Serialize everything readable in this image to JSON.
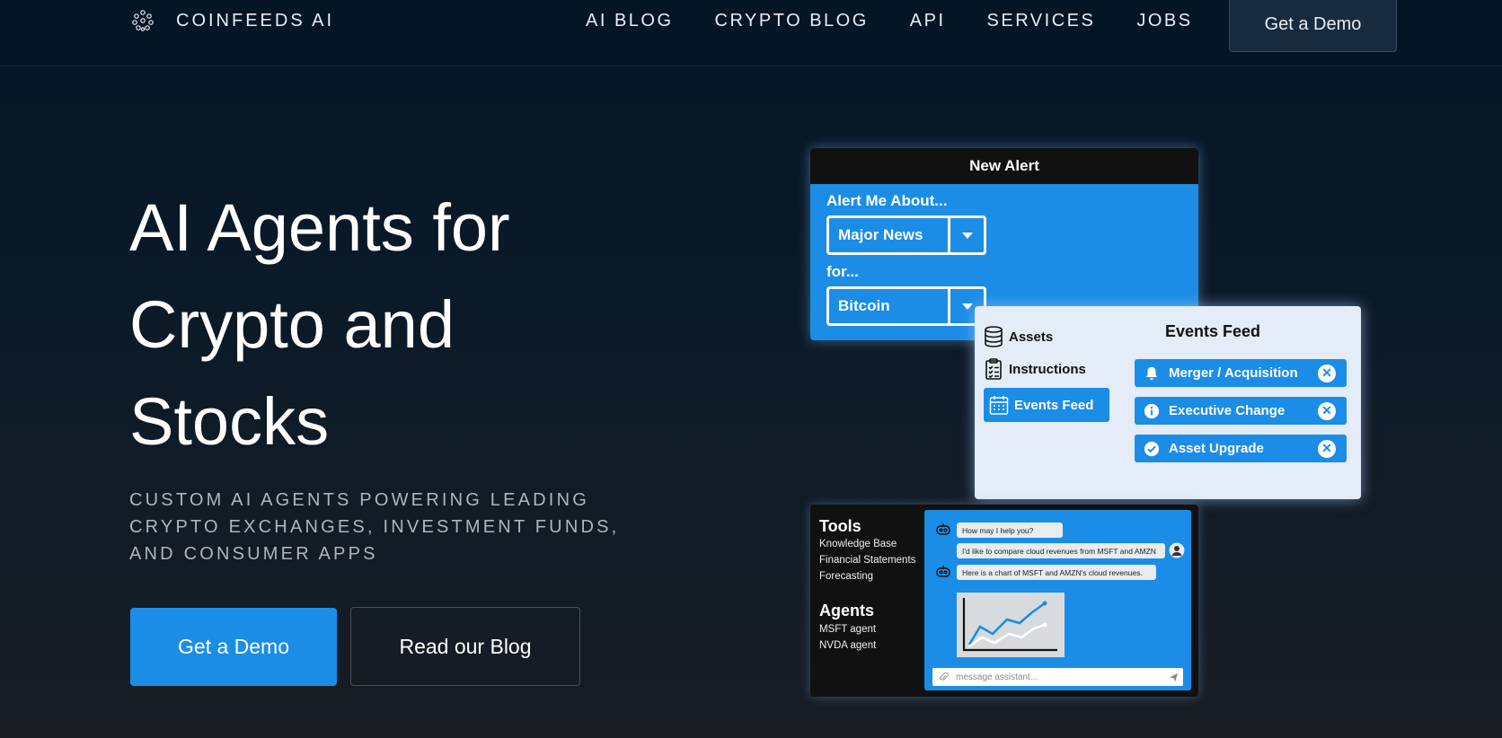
{
  "nav": {
    "brand": "COINFEEDS AI",
    "links": [
      "AI BLOG",
      "CRYPTO BLOG",
      "API",
      "SERVICES",
      "JOBS"
    ],
    "cta": "Get a Demo"
  },
  "hero": {
    "title_line1": "AI Agents for",
    "title_line2": "Crypto and",
    "title_line3": "Stocks",
    "subtitle_line1": "CUSTOM AI AGENTS POWERING LEADING",
    "subtitle_line2": "CRYPTO EXCHANGES, INVESTMENT FUNDS,",
    "subtitle_line3": "AND CONSUMER APPS",
    "primary_cta": "Get a Demo",
    "secondary_cta": "Read our Blog"
  },
  "alert_card": {
    "header": "New Alert",
    "label_about": "Alert Me About...",
    "select_topic": "Major News",
    "label_for": "for...",
    "select_asset": "Bitcoin"
  },
  "events_card": {
    "sidebar": [
      "Assets",
      "Instructions",
      "Events Feed"
    ],
    "title": "Events Feed",
    "items": [
      "Merger / Acquisition",
      "Executive Change",
      "Asset Upgrade"
    ],
    "close_glyph": "✕"
  },
  "chat_card": {
    "tools_heading": "Tools",
    "tools": [
      "Knowledge Base",
      "Financial Statements",
      "Forecasting"
    ],
    "agents_heading": "Agents",
    "agents": [
      "MSFT agent",
      "NVDA agent"
    ],
    "messages": [
      "How may I help you?",
      "I'd like to compare cloud revenues from MSFT and AMZN",
      "Here is a chart of MSFT and AMZN's cloud revenues."
    ],
    "input_placeholder": "message assistant..."
  },
  "colors": {
    "accent": "#1b8de6",
    "nav_bg": "#041526",
    "page_bg": "#0b1a28"
  }
}
